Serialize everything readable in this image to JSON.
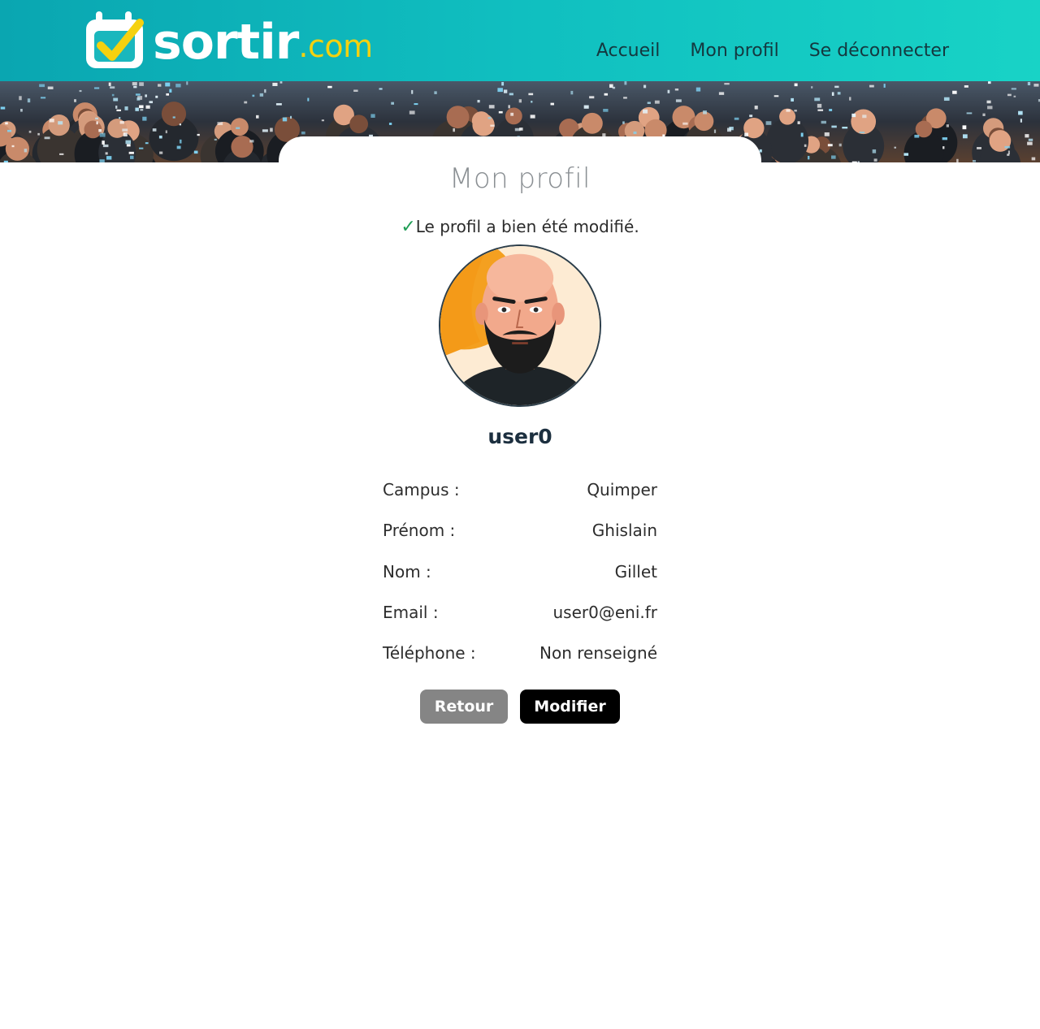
{
  "header": {
    "logo_main": "sortir",
    "logo_suffix": ".com",
    "nav": [
      {
        "label": "Accueil"
      },
      {
        "label": "Mon profil"
      },
      {
        "label": "Se déconnecter"
      }
    ]
  },
  "page": {
    "title": "Mon profil",
    "flash_icon": "✓",
    "flash_message": "Le profil a bien été modifié."
  },
  "profile": {
    "avatar_icon": "bearded-man-avatar",
    "username": "user0",
    "fields": [
      {
        "label": "Campus :",
        "value": "Quimper"
      },
      {
        "label": "Prénom :",
        "value": "Ghislain"
      },
      {
        "label": "Nom :",
        "value": "Gillet"
      },
      {
        "label": "Email :",
        "value": "user0@eni.fr"
      },
      {
        "label": "Téléphone :",
        "value": "Non renseigné"
      }
    ]
  },
  "actions": {
    "back_label": "Retour",
    "edit_label": "Modifier"
  },
  "colors": {
    "header_start": "#0aa6b1",
    "header_end": "#18d3c6",
    "logo_accent": "#f5d10f",
    "success": "#1f9d55",
    "back_button": "#858585",
    "edit_button": "#000000"
  }
}
